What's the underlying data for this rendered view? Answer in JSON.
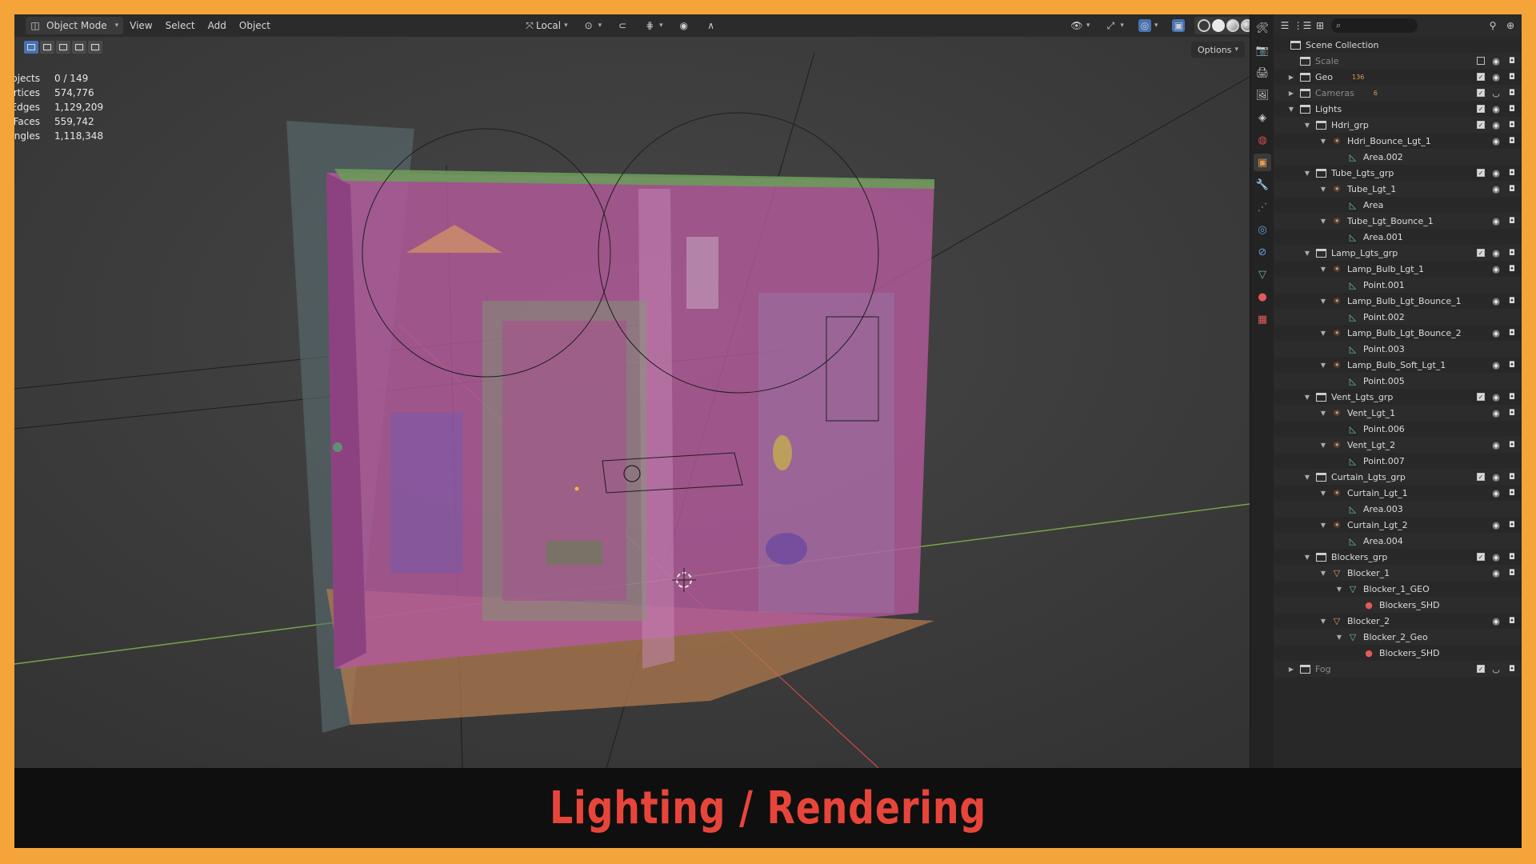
{
  "header": {
    "mode_label": "Object Mode",
    "menus": [
      "View",
      "Select",
      "Add",
      "Object"
    ],
    "transform_orientation": "Local",
    "options_label": "Options"
  },
  "stats": [
    {
      "label": "Objects",
      "value": "0 / 149"
    },
    {
      "label": "Vertices",
      "value": "574,776"
    },
    {
      "label": "Edges",
      "value": "1,129,209"
    },
    {
      "label": "Faces",
      "value": "559,742"
    },
    {
      "label": "Triangles",
      "value": "1,118,348"
    }
  ],
  "outliner": {
    "root": "Scene Collection",
    "badges": {
      "geo": "136",
      "cameras": "6"
    },
    "rows": [
      {
        "label": "Scale",
        "depth": 1,
        "kind": "collection",
        "dim": true,
        "exp": ""
      },
      {
        "label": "Geo",
        "depth": 1,
        "kind": "collection",
        "dim": false,
        "exp": "closed"
      },
      {
        "label": "Cameras",
        "depth": 1,
        "kind": "collection",
        "dim": true,
        "exp": "closed"
      },
      {
        "label": "Lights",
        "depth": 1,
        "kind": "collection",
        "dim": false,
        "exp": "open"
      },
      {
        "label": "Hdri_grp",
        "depth": 2,
        "kind": "collection",
        "dim": false,
        "exp": "open"
      },
      {
        "label": "Hdri_Bounce_Lgt_1",
        "depth": 3,
        "kind": "light",
        "dim": false,
        "exp": "open"
      },
      {
        "label": "Area.002",
        "depth": 4,
        "kind": "data",
        "dim": false,
        "exp": ""
      },
      {
        "label": "Tube_Lgts_grp",
        "depth": 2,
        "kind": "collection",
        "dim": false,
        "exp": "open"
      },
      {
        "label": "Tube_Lgt_1",
        "depth": 3,
        "kind": "light",
        "dim": false,
        "exp": "open"
      },
      {
        "label": "Area",
        "depth": 4,
        "kind": "data",
        "dim": false,
        "exp": ""
      },
      {
        "label": "Tube_Lgt_Bounce_1",
        "depth": 3,
        "kind": "light",
        "dim": false,
        "exp": "open"
      },
      {
        "label": "Area.001",
        "depth": 4,
        "kind": "data",
        "dim": false,
        "exp": ""
      },
      {
        "label": "Lamp_Lgts_grp",
        "depth": 2,
        "kind": "collection",
        "dim": false,
        "exp": "open"
      },
      {
        "label": "Lamp_Bulb_Lgt_1",
        "depth": 3,
        "kind": "light",
        "dim": false,
        "exp": "open"
      },
      {
        "label": "Point.001",
        "depth": 4,
        "kind": "data",
        "dim": false,
        "exp": ""
      },
      {
        "label": "Lamp_Bulb_Lgt_Bounce_1",
        "depth": 3,
        "kind": "light",
        "dim": false,
        "exp": "open"
      },
      {
        "label": "Point.002",
        "depth": 4,
        "kind": "data",
        "dim": false,
        "exp": ""
      },
      {
        "label": "Lamp_Bulb_Lgt_Bounce_2",
        "depth": 3,
        "kind": "light",
        "dim": false,
        "exp": "open"
      },
      {
        "label": "Point.003",
        "depth": 4,
        "kind": "data",
        "dim": false,
        "exp": ""
      },
      {
        "label": "Lamp_Bulb_Soft_Lgt_1",
        "depth": 3,
        "kind": "light",
        "dim": false,
        "exp": "open"
      },
      {
        "label": "Point.005",
        "depth": 4,
        "kind": "data",
        "dim": false,
        "exp": ""
      },
      {
        "label": "Vent_Lgts_grp",
        "depth": 2,
        "kind": "collection",
        "dim": false,
        "exp": "open"
      },
      {
        "label": "Vent_Lgt_1",
        "depth": 3,
        "kind": "light",
        "dim": false,
        "exp": "open"
      },
      {
        "label": "Point.006",
        "depth": 4,
        "kind": "data",
        "dim": false,
        "exp": ""
      },
      {
        "label": "Vent_Lgt_2",
        "depth": 3,
        "kind": "light",
        "dim": false,
        "exp": "open"
      },
      {
        "label": "Point.007",
        "depth": 4,
        "kind": "data",
        "dim": false,
        "exp": ""
      },
      {
        "label": "Curtain_Lgts_grp",
        "depth": 2,
        "kind": "collection",
        "dim": false,
        "exp": "open"
      },
      {
        "label": "Curtain_Lgt_1",
        "depth": 3,
        "kind": "light",
        "dim": false,
        "exp": "open"
      },
      {
        "label": "Area.003",
        "depth": 4,
        "kind": "data",
        "dim": false,
        "exp": ""
      },
      {
        "label": "Curtain_Lgt_2",
        "depth": 3,
        "kind": "light",
        "dim": false,
        "exp": "open"
      },
      {
        "label": "Area.004",
        "depth": 4,
        "kind": "data",
        "dim": false,
        "exp": ""
      },
      {
        "label": "Blockers_grp",
        "depth": 2,
        "kind": "collection",
        "dim": false,
        "exp": "open"
      },
      {
        "label": "Blocker_1",
        "depth": 3,
        "kind": "geo",
        "dim": false,
        "exp": "open"
      },
      {
        "label": "Blocker_1_GEO",
        "depth": 4,
        "kind": "mesh",
        "dim": false,
        "exp": "open"
      },
      {
        "label": "Blockers_SHD",
        "depth": 5,
        "kind": "material",
        "dim": false,
        "exp": ""
      },
      {
        "label": "Blocker_2",
        "depth": 3,
        "kind": "geo",
        "dim": false,
        "exp": "open"
      },
      {
        "label": "Blocker_2_Geo",
        "depth": 4,
        "kind": "mesh",
        "dim": false,
        "exp": "open"
      },
      {
        "label": "Blockers_SHD",
        "depth": 5,
        "kind": "material",
        "dim": false,
        "exp": ""
      },
      {
        "label": "Fog",
        "depth": 1,
        "kind": "collection",
        "dim": true,
        "exp": "closed"
      }
    ]
  },
  "caption": "Lighting / Rendering",
  "colors": {
    "frame": "#f5a43a",
    "caption": "#e8453a",
    "accent": "#4772b3"
  }
}
